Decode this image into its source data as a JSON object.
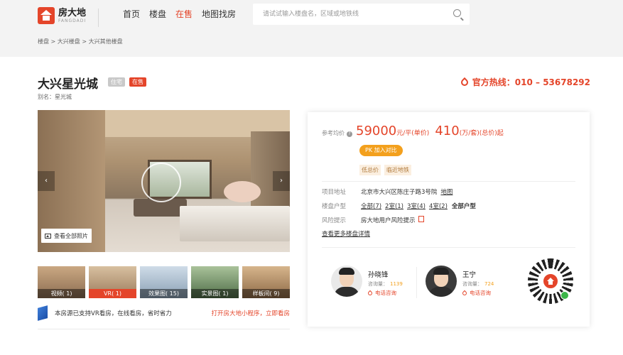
{
  "header": {
    "logo_cn": "房大地",
    "logo_en": "FANGDADI",
    "nav": [
      "首页",
      "楼盘",
      "在售",
      "地图找房"
    ],
    "nav_active_index": 2,
    "search_placeholder": "请试试输入楼盘名，区域或地铁线"
  },
  "breadcrumb": "楼盘 > 大兴楼盘 > 大兴其他楼盘",
  "project": {
    "title": "大兴星光城",
    "tag_type": "住宅",
    "tag_status": "在售",
    "alias": "别名：星光城",
    "hotline": "官方热线：010 – 53678292"
  },
  "gallery": {
    "view_all": "查看全部照片",
    "prev": "‹",
    "next": "›",
    "thumbs": [
      {
        "label": "视频( 1)",
        "active": false
      },
      {
        "label": "VR( 1)",
        "active": true
      },
      {
        "label": "效果图( 15)",
        "active": false
      },
      {
        "label": "实景图( 1)",
        "active": false
      },
      {
        "label": "样板间( 9)",
        "active": false
      }
    ],
    "vr_text": "本房源已支持VR看房，在线看房，省时省力",
    "vr_link": "打开房大地小程序，立即看房"
  },
  "price": {
    "label": "参考均价",
    "help": "?",
    "unit_price": "59000",
    "unit_price_suffix": "元/平(单价)",
    "total_price": "410",
    "total_price_suffix": "(万/套)(总价)起",
    "compare_button": "PK  加入对比",
    "tags": [
      "低总价",
      "临近地铁"
    ]
  },
  "info": {
    "address_label": "项目地址",
    "address": "北京市大兴区陈庄子路3号院",
    "map_link": "地图",
    "layout_label": "楼盘户型",
    "layouts": [
      "全部(7)",
      "2室(1)",
      "3室(4)",
      "4室(2)"
    ],
    "layouts_all": "全部户型",
    "risk_label": "风险提示",
    "risk_text": "房大地用户风险提示",
    "more_link": "查看更多楼盘详情"
  },
  "agents": [
    {
      "name": "孙晓锋",
      "count_label": "咨询量：",
      "count": "1139",
      "call": "电话咨询"
    },
    {
      "name": "王宁",
      "count_label": "咨询量：",
      "count": "724",
      "call": "电话咨询"
    }
  ],
  "colors": {
    "accent": "#e4452a",
    "compare": "#f3a01d",
    "vr": "#1b4fa8"
  }
}
